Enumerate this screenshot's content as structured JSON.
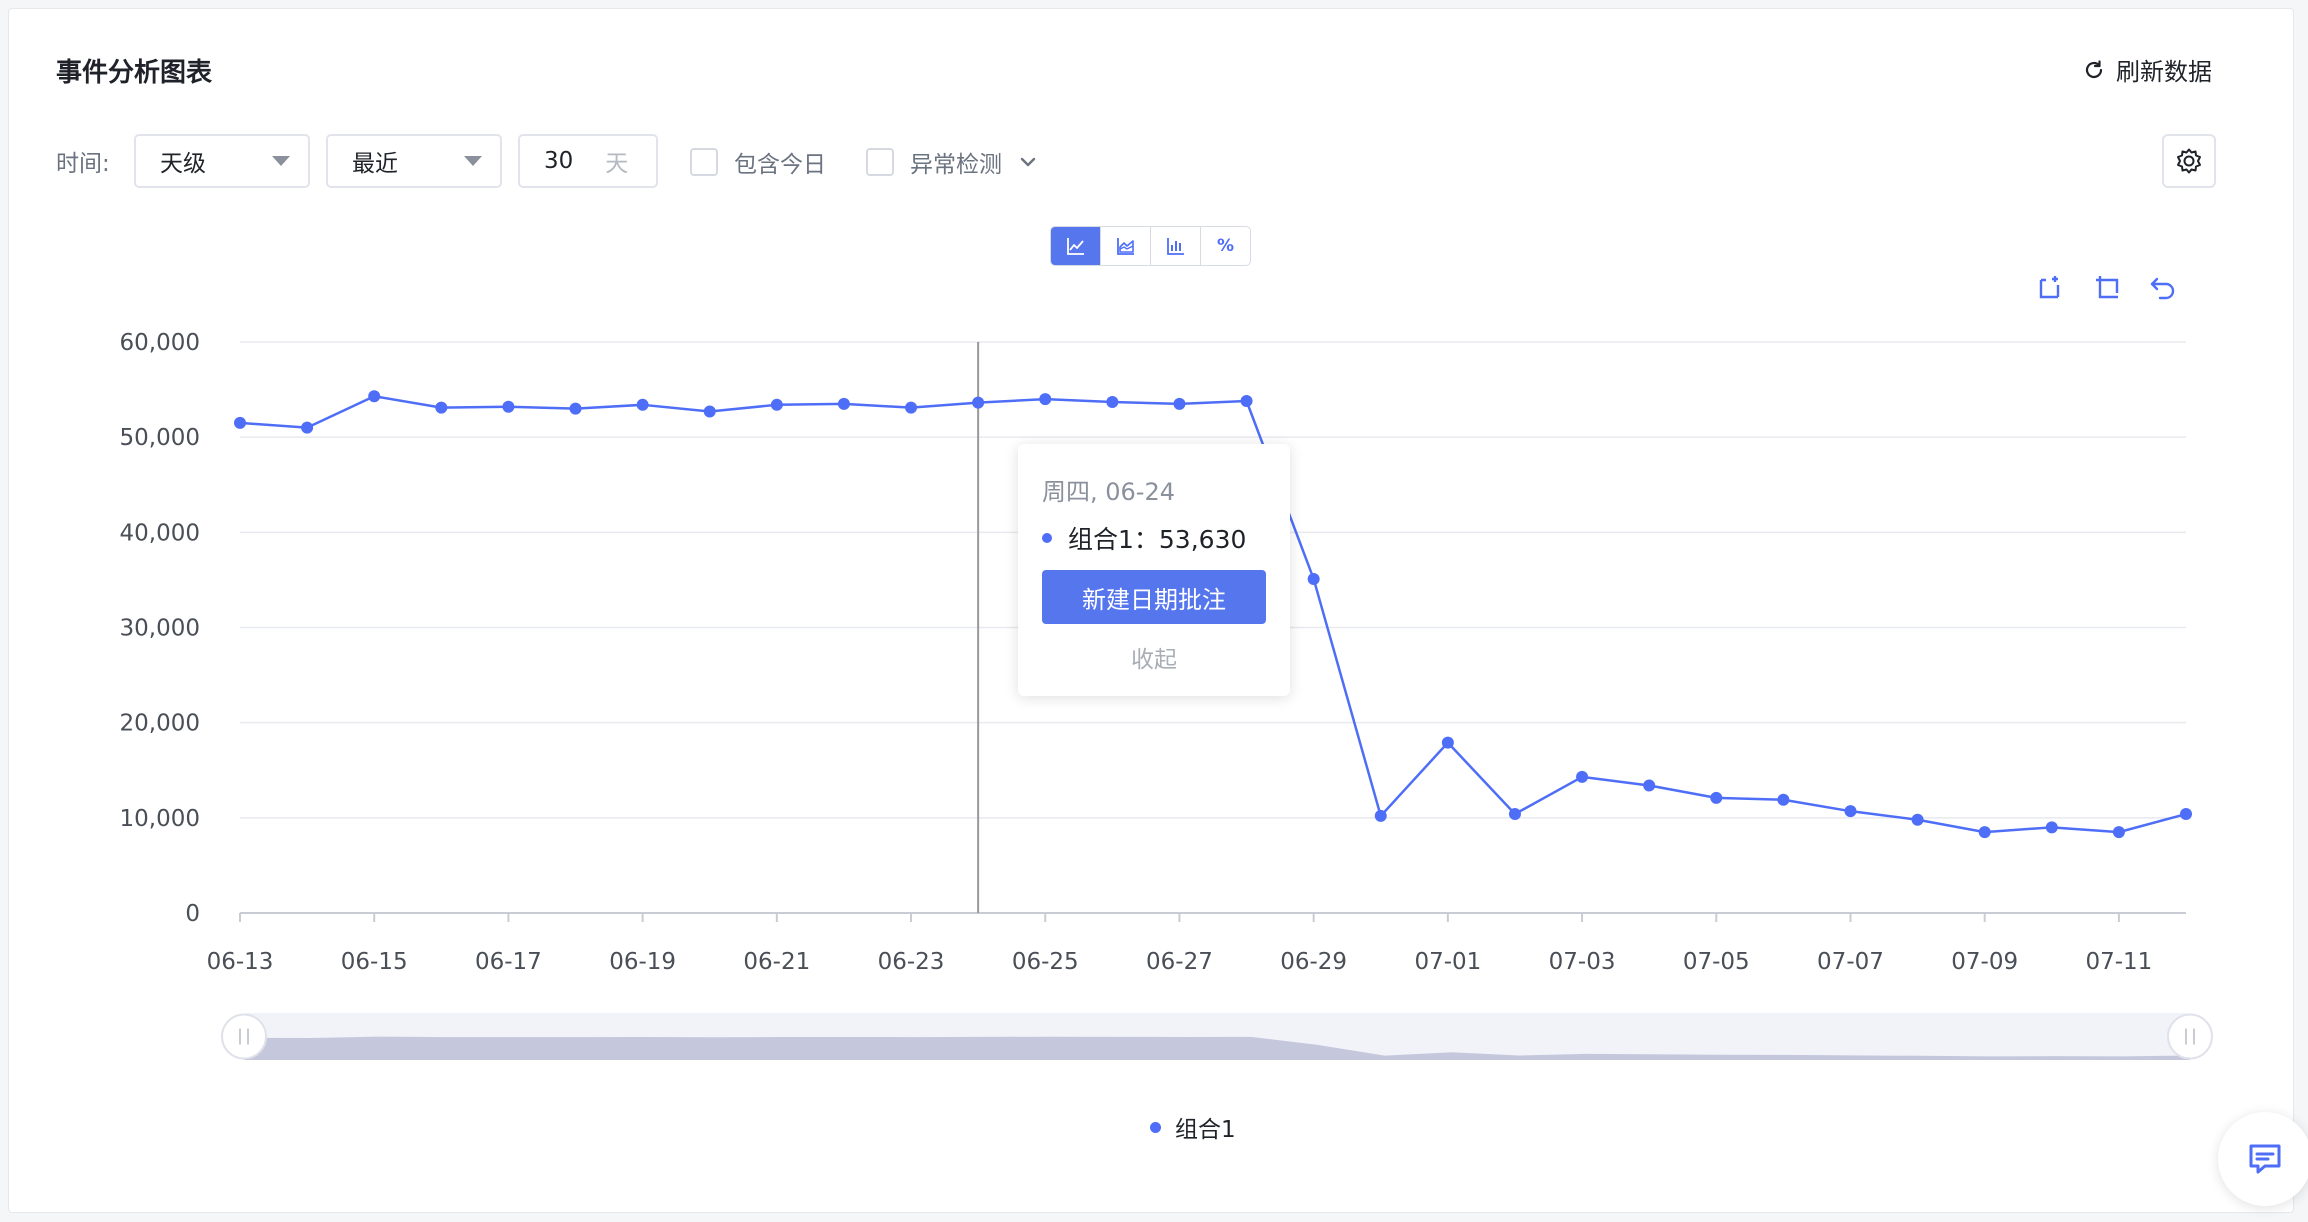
{
  "header": {
    "title": "事件分析图表",
    "refresh_label": "刷新数据"
  },
  "filters": {
    "time_label": "时间:",
    "granularity": "天级",
    "range_mode": "最近",
    "days_value": "30",
    "days_unit": "天",
    "include_today_label": "包含今日",
    "anomaly_label": "异常检测"
  },
  "chart_types": [
    {
      "name": "line",
      "icon": "line-chart-icon",
      "active": true
    },
    {
      "name": "area",
      "icon": "area-chart-icon",
      "active": false
    },
    {
      "name": "bar",
      "icon": "bar-chart-icon",
      "active": false
    },
    {
      "name": "percent",
      "label": "%",
      "active": false
    }
  ],
  "tooltip": {
    "date": "周四, 06-24",
    "series_label": "组合1：53,630",
    "create_annotation_label": "新建日期批注",
    "collapse_label": "收起"
  },
  "legend": {
    "label": "组合1"
  },
  "colors": {
    "series": "#4f6ef7",
    "primary_button": "#5676ee",
    "grid": "#e8eaef",
    "zoom_fill": "#c5c8dd"
  },
  "chart_data": {
    "type": "line",
    "x": [
      "06-13",
      "06-14",
      "06-15",
      "06-16",
      "06-17",
      "06-18",
      "06-19",
      "06-20",
      "06-21",
      "06-22",
      "06-23",
      "06-24",
      "06-25",
      "06-26",
      "06-27",
      "06-28",
      "06-29",
      "06-30",
      "07-01",
      "07-02",
      "07-03",
      "07-04",
      "07-05",
      "07-06",
      "07-07",
      "07-08",
      "07-09",
      "07-10",
      "07-11",
      "07-12"
    ],
    "x_tick_labels": [
      "06-13",
      "06-15",
      "06-17",
      "06-19",
      "06-21",
      "06-23",
      "06-25",
      "06-27",
      "06-29",
      "07-01",
      "07-03",
      "07-05",
      "07-07",
      "07-09",
      "07-11"
    ],
    "series": [
      {
        "name": "组合1",
        "values": [
          51500,
          51000,
          54300,
          53100,
          53200,
          53000,
          53400,
          52700,
          53400,
          53500,
          53100,
          53630,
          54000,
          53700,
          53500,
          53800,
          35100,
          10200,
          17900,
          10400,
          14300,
          13400,
          12100,
          11900,
          10700,
          9800,
          8500,
          9000,
          8500,
          10400
        ]
      }
    ],
    "ylim": [
      0,
      60000
    ],
    "y_ticks": [
      "0",
      "10,000",
      "20,000",
      "30,000",
      "40,000",
      "50,000",
      "60,000"
    ],
    "highlight_x": "06-24",
    "grid": true,
    "legend_position": "bottom-center"
  }
}
